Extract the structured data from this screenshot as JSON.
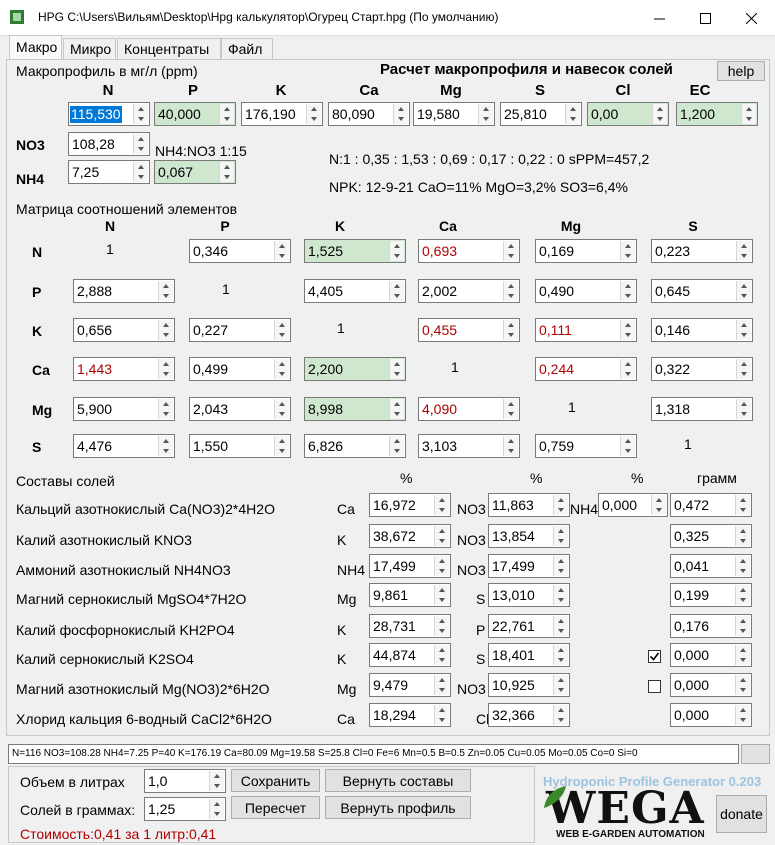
{
  "window": {
    "title": "HPG C:\\Users\\Вильям\\Desktop\\Hpg калькулятор\\Огурец Старт.hpg (По умолчанию)"
  },
  "tabs": [
    "Макро",
    "Микро",
    "Концентраты",
    "Файл"
  ],
  "macro": {
    "profile_label": "Макропрофиль в мг/л (ppm)",
    "heading": "Расчет макропрофиля и навесок солей",
    "help": "help",
    "headers": [
      "N",
      "P",
      "K",
      "Ca",
      "Mg",
      "S",
      "Cl",
      "EC"
    ],
    "values": [
      "115,530",
      "40,000",
      "176,190",
      "80,090",
      "19,580",
      "25,810",
      "0,00",
      "1,200"
    ],
    "no3_label": "NO3",
    "no3": "108,28",
    "nh4_label": "NH4",
    "nh4": "7,25",
    "nh4_ratio_value": "0,067",
    "nh4no3_ratio": "NH4:NO3 1:15",
    "ratio_line": "N:1 : 0,35 : 1,53 : 0,69 : 0,17 : 0,22 : 0 sPPM=457,2",
    "npk_line": "NPK: 12-9-21 CaO=11% MgO=3,2% SO3=6,4%"
  },
  "matrix": {
    "label": "Матрица соотношений элементов",
    "col_headers": [
      "N",
      "P",
      "K",
      "Ca",
      "Mg",
      "S"
    ],
    "row_headers": [
      "N",
      "P",
      "K",
      "Ca",
      "Mg",
      "S"
    ],
    "rows": [
      [
        "1",
        "0,346",
        "1,525",
        "0,693",
        "0,169",
        "0,223"
      ],
      [
        "2,888",
        "1",
        "4,405",
        "2,002",
        "0,490",
        "0,645"
      ],
      [
        "0,656",
        "0,227",
        "1",
        "0,455",
        "0,111",
        "0,146"
      ],
      [
        "1,443",
        "0,499",
        "2,200",
        "1",
        "0,244",
        "0,322"
      ],
      [
        "5,900",
        "2,043",
        "8,998",
        "4,090",
        "1",
        "1,318"
      ],
      [
        "4,476",
        "1,550",
        "6,826",
        "3,103",
        "0,759",
        "1"
      ]
    ]
  },
  "salts": {
    "label": "Составы солей",
    "pct": "%",
    "gram": "грамм",
    "items": [
      {
        "name": "Кальций азотнокислый Ca(NO3)2*4H2O",
        "e1": "Ca",
        "v1": "16,972",
        "e2": "NO3",
        "v2": "11,863",
        "e3": "NH4",
        "v3": "0,000",
        "g": "0,472"
      },
      {
        "name": "Калий азотнокислый KNO3",
        "e1": "K",
        "v1": "38,672",
        "e2": "NO3",
        "v2": "13,854",
        "g": "0,325"
      },
      {
        "name": "Аммоний азотнокислый NH4NO3",
        "e1": "NH4",
        "v1": "17,499",
        "e2": "NO3",
        "v2": "17,499",
        "g": "0,041"
      },
      {
        "name": "Магний сернокислый MgSO4*7H2O",
        "e1": "Mg",
        "v1": "9,861",
        "e2": "S",
        "v2": "13,010",
        "g": "0,199"
      },
      {
        "name": "Калий фосфорнокислый KH2PO4",
        "e1": "K",
        "v1": "28,731",
        "e2": "P",
        "v2": "22,761",
        "g": "0,176"
      },
      {
        "name": "Калий сернокислый K2SO4",
        "e1": "K",
        "v1": "44,874",
        "e2": "S",
        "v2": "18,401",
        "g": "0,000",
        "checked": true
      },
      {
        "name": "Магний азотнокислый Mg(NO3)2*6H2O",
        "e1": "Mg",
        "v1": "9,479",
        "e2": "NO3",
        "v2": "10,925",
        "g": "0,000",
        "checked": false
      },
      {
        "name": "Хлорид кальция 6-водный CaCl2*6H2O",
        "e1": "Ca",
        "v1": "18,294",
        "e2": "Cl",
        "v2": "32,366",
        "g": "0,000"
      }
    ]
  },
  "status_line": "N=116 NO3=108.28 NH4=7.25 P=40 K=176.19 Ca=80.09 Mg=19.58 S=25.8 Cl=0 Fe=6 Mn=0.5 B=0.5 Zn=0.05 Cu=0.05 Mo=0.05 Co=0 Si=0",
  "bottom": {
    "volume_label": "Объем в литрах",
    "volume": "1,0",
    "salts_label": "Солей в граммах:",
    "salts_grams": "1,25",
    "save": "Сохранить",
    "recalc": "Пересчет",
    "restore_salts": "Вернуть составы",
    "restore_profile": "Вернуть профиль",
    "cost": "Стоимость:0,41 за 1 литр:0,41",
    "app_name": "Hydroponic Profile Generator 0.203",
    "logo": "WEGA",
    "logo_sub": "WEB E-GARDEN AUTOMATION",
    "donate": "donate"
  },
  "colors": {
    "highlight_green": "#cfe6cf",
    "warn_red": "#b00000",
    "selection": "#0078d7",
    "logo_green": "#3a8a2a"
  }
}
